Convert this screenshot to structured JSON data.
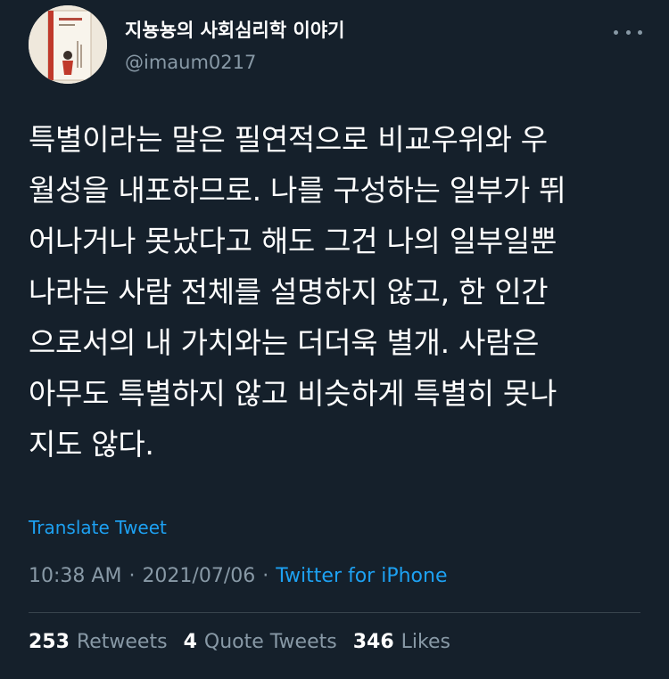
{
  "author": {
    "name": "지뇽뇽의 사회심리학 이야기",
    "handle": "@imaum0217"
  },
  "tweet": {
    "text": "특별이라는 말은 필연적으로 비교우위와 우\n월성을 내포하므로. 나를 구성하는 일부가 뛰\n어나거나 못났다고 해도 그건 나의 일부일뿐\n나라는 사람 전체를 설명하지 않고, 한 인간\n으로서의 내 가치와는 더더욱 별개. 사람은\n아무도 특별하지 않고 비슷하게 특별히 못나\n지도 않다.",
    "translate_label": "Translate Tweet",
    "time": "10:38 AM",
    "date": "2021/07/06",
    "separator": "·",
    "source": "Twitter for iPhone"
  },
  "stats": {
    "retweets_count": "253",
    "retweets_label": "Retweets",
    "quotes_count": "4",
    "quotes_label": "Quote Tweets",
    "likes_count": "346",
    "likes_label": "Likes"
  },
  "colors": {
    "background": "#15202b",
    "text_primary": "#ffffff",
    "text_secondary": "#8899a6",
    "accent": "#1da1f2",
    "divider": "#38444d"
  },
  "icons": {
    "more": "more-horizontal-icon"
  }
}
